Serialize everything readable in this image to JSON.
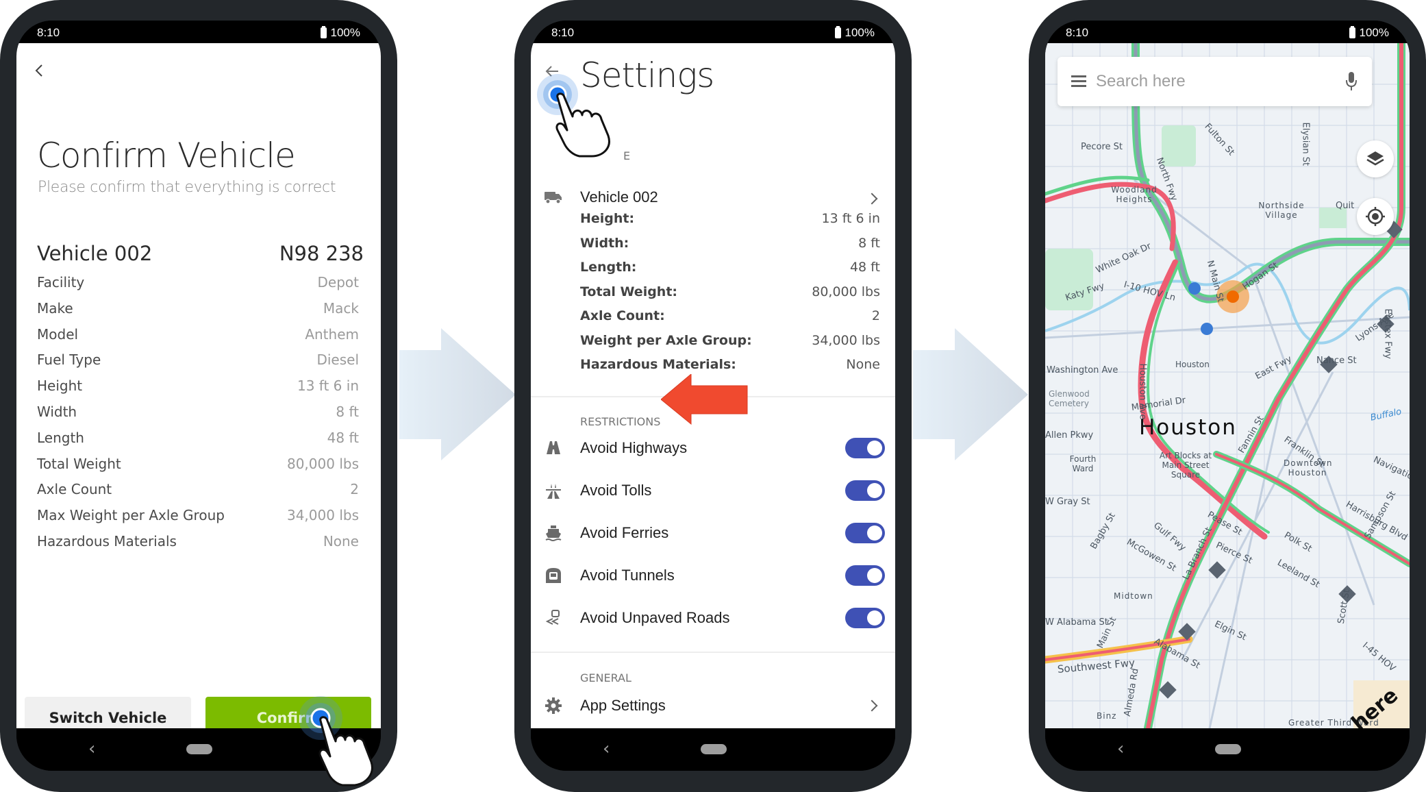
{
  "status_bar": {
    "time": "8:10",
    "battery": "100%"
  },
  "phone1": {
    "title": "Confirm Vehicle",
    "subtitle": "Please confirm that everything is correct",
    "vehicle_name": "Vehicle 002",
    "vehicle_plate": "N98 238",
    "rows": [
      {
        "label": "Facility",
        "value": "Depot"
      },
      {
        "label": "Make",
        "value": "Mack"
      },
      {
        "label": "Model",
        "value": "Anthem"
      },
      {
        "label": "Fuel Type",
        "value": "Diesel"
      },
      {
        "label": "Height",
        "value": "13 ft 6 in"
      },
      {
        "label": "Width",
        "value": "8 ft"
      },
      {
        "label": "Length",
        "value": "48 ft"
      },
      {
        "label": "Total Weight",
        "value": "80,000 lbs"
      },
      {
        "label": "Axle Count",
        "value": "2"
      },
      {
        "label": "Max Weight per Axle Group",
        "value": "34,000 lbs"
      },
      {
        "label": "Hazardous Materials",
        "value": "None"
      }
    ],
    "buttons": {
      "switch": "Switch Vehicle",
      "confirm": "Confirm"
    },
    "colors": {
      "confirm": "#7cbb00"
    }
  },
  "phone2": {
    "title": "Settings",
    "vehicle_section_hidden": "E",
    "vehicle": "Vehicle 002",
    "specs": [
      {
        "label": "Height:",
        "value": "13 ft 6 in"
      },
      {
        "label": "Width:",
        "value": "8 ft"
      },
      {
        "label": "Length:",
        "value": "48 ft"
      },
      {
        "label": "Total Weight:",
        "value": "80,000 lbs"
      },
      {
        "label": "Axle Count:",
        "value": "2"
      },
      {
        "label": "Weight per Axle Group:",
        "value": "34,000 lbs"
      },
      {
        "label": "Hazardous Materials:",
        "value": "None"
      }
    ],
    "restrictions_header": "RESTRICTIONS",
    "restrictions": [
      {
        "label": "Avoid Highways",
        "icon": "highway-icon",
        "on": true
      },
      {
        "label": "Avoid Tolls",
        "icon": "toll-road-icon",
        "on": true
      },
      {
        "label": "Avoid Ferries",
        "icon": "ferry-icon",
        "on": true
      },
      {
        "label": "Avoid Tunnels",
        "icon": "tunnel-icon",
        "on": true
      },
      {
        "label": "Avoid Unpaved Roads",
        "icon": "unpaved-road-icon",
        "on": true
      }
    ],
    "general_header": "GENERAL",
    "app_settings": "App Settings",
    "colors": {
      "toggle": "#3f51b5",
      "annotation_arrow": "#f04a2f"
    }
  },
  "phone3": {
    "search_placeholder": "Search here",
    "city": "Houston",
    "labels": [
      "Pecore St",
      "Fulton St",
      "Elysian St",
      "Woodland Heights",
      "Northside Village",
      "Quit",
      "North Fwy",
      "White Oak Dr",
      "Katy Fwy",
      "I-10 HOV Ln",
      "East Fwy",
      "N Main St",
      "Hogan St",
      "Washington Ave",
      "Houston Ave",
      "Houston",
      "Glenwood Cemetery",
      "Memorial Dr",
      "Nance St",
      "Lyons Ave",
      "Eastex Fwy",
      "Allen Pkwy",
      "Fannin St",
      "Franklin St",
      "Buffalo",
      "Fourth Ward",
      "Art Blocks at Main Street Square",
      "Downtown Houston",
      "Navigation",
      "W Gray St",
      "Harrisburg Blvd",
      "Pease St",
      "Gulf Fwy",
      "Bagby St",
      "McGowen St",
      "La Branch St",
      "Pierce St",
      "Polk St",
      "Leeland St",
      "Sampson St",
      "Midtown",
      "W Alabama St",
      "Main St",
      "Elgin St",
      "Alabama St",
      "Scott St",
      "I-45 HOV",
      "Southwest Fwy",
      "Almeda Rd",
      "Binz",
      "Greater Third Ward"
    ],
    "brand": "here"
  }
}
